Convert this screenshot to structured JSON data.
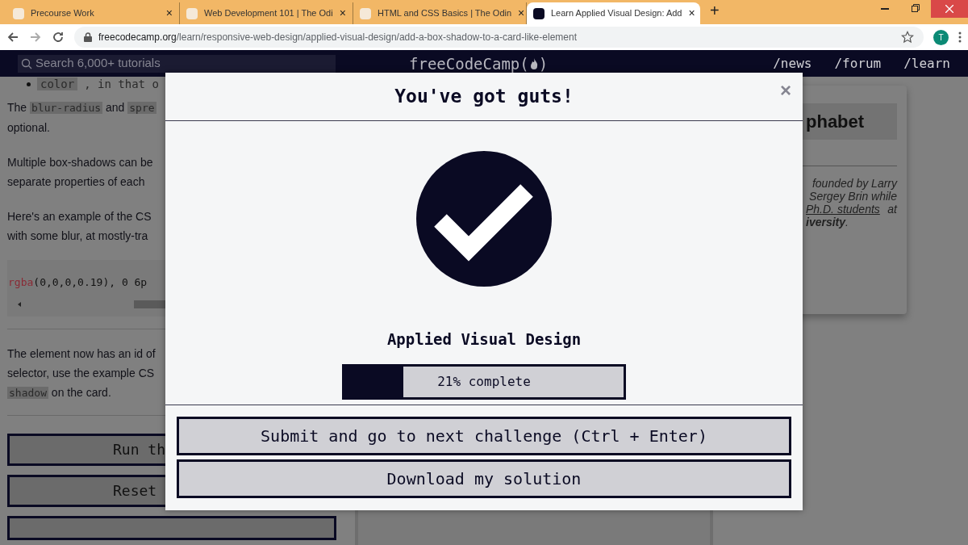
{
  "browser": {
    "tabs": [
      {
        "title": "Precourse Work",
        "close": "×",
        "selected": false
      },
      {
        "title": "Web Development 101 | The Odi",
        "close": "×",
        "selected": false
      },
      {
        "title": "HTML and CSS Basics | The Odin",
        "close": "×",
        "selected": false
      },
      {
        "title": "Learn Applied Visual Design: Add",
        "close": "×",
        "selected": true
      }
    ],
    "new_tab": "+",
    "url_host": "freecodecamp.org",
    "url_path": "/learn/responsive-web-design/applied-visual-design/add-a-box-shadow-to-a-card-like-element",
    "avatar": "T"
  },
  "navbar": {
    "search_placeholder": "Search 6,000+ tutorials",
    "logo_before": "freeCodeCamp(",
    "logo_after": ")",
    "links": [
      "/news",
      "/forum",
      "/learn"
    ]
  },
  "lesson": {
    "bullet_code": "color",
    "bullet_text": ", in that o",
    "paragraphs": [
      [
        {
          "kind": "text",
          "text": "The "
        },
        {
          "kind": "code",
          "text": "blur-radius"
        },
        {
          "kind": "text",
          "text": " and "
        },
        {
          "kind": "code",
          "text": "spre"
        },
        {
          "kind": "break"
        },
        {
          "kind": "text",
          "text": "optional."
        }
      ],
      [
        {
          "kind": "text",
          "text": "Multiple box-shadows can be"
        },
        {
          "kind": "break"
        },
        {
          "kind": "text",
          "text": "separate properties of each"
        }
      ],
      [
        {
          "kind": "text",
          "text": "Here's an example of the CS"
        },
        {
          "kind": "break"
        },
        {
          "kind": "text",
          "text": "with some blur, at mostly-tra"
        }
      ]
    ],
    "code_fn": "rgba",
    "code_rest": "(0,0,0,0.19), 0 6p",
    "instructions": [
      {
        "kind": "text",
        "text": "The element now has an id of"
      },
      {
        "kind": "break"
      },
      {
        "kind": "text",
        "text": "selector, use the example CS"
      },
      {
        "kind": "break"
      },
      {
        "kind": "code",
        "text": "shadow"
      },
      {
        "kind": "text",
        "text": " on the card."
      }
    ],
    "buttons": [
      "Run th",
      "Reset"
    ]
  },
  "card": {
    "heading": "phabet",
    "lines": [
      "founded by Larry",
      "Sergey Brin while"
    ],
    "link": "Ph.D. students",
    "after_link": "at",
    "last_bold": "iversity",
    "last_end": "."
  },
  "modal": {
    "title": "You've got guts!",
    "close": "×",
    "block": "Applied Visual Design",
    "progress": {
      "level": 0.21,
      "label": "21% complete"
    },
    "buttons": [
      "Submit and go to next challenge (Ctrl + Enter)",
      "Download my solution"
    ]
  }
}
